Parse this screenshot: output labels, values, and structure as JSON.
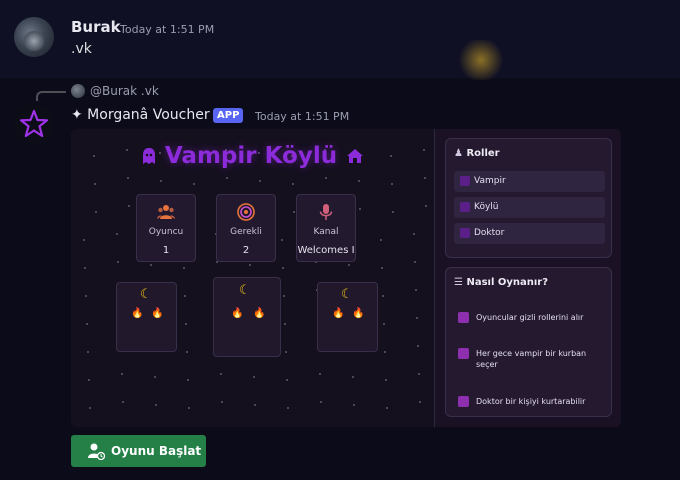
{
  "message1": {
    "username": "Burak",
    "timestamp": "Today at 1:51 PM",
    "text": ".vk"
  },
  "reply": {
    "username": "@Burak",
    "text": ".vk"
  },
  "message2": {
    "bot_name": "✦ Morganâ Voucher",
    "badge": "APP",
    "timestamp": "Today at 1:51 PM"
  },
  "game": {
    "title": "Vampir Köylü",
    "stats": [
      {
        "label": "Oyuncu",
        "value": "1",
        "icon": "users-icon"
      },
      {
        "label": "Gerekli",
        "value": "2",
        "icon": "target-icon"
      },
      {
        "label": "Kanal",
        "value": "Welcomes I",
        "icon": "microphone-icon"
      }
    ]
  },
  "roles": {
    "title": "Roller",
    "items": [
      "Vampir",
      "Köylü",
      "Doktor"
    ]
  },
  "howto": {
    "title": "Nasıl Oynanır?",
    "items": [
      "Oyuncular gizli rollerini alır",
      "Her gece vampir bir kurban seçer",
      "Doktor bir kişiyi kurtarabilir"
    ]
  },
  "button": {
    "label": "Oyunu Başlat"
  },
  "colors": {
    "title_purple": "#8b2bd9",
    "button_green": "#248046",
    "app_badge": "#5865f2"
  }
}
